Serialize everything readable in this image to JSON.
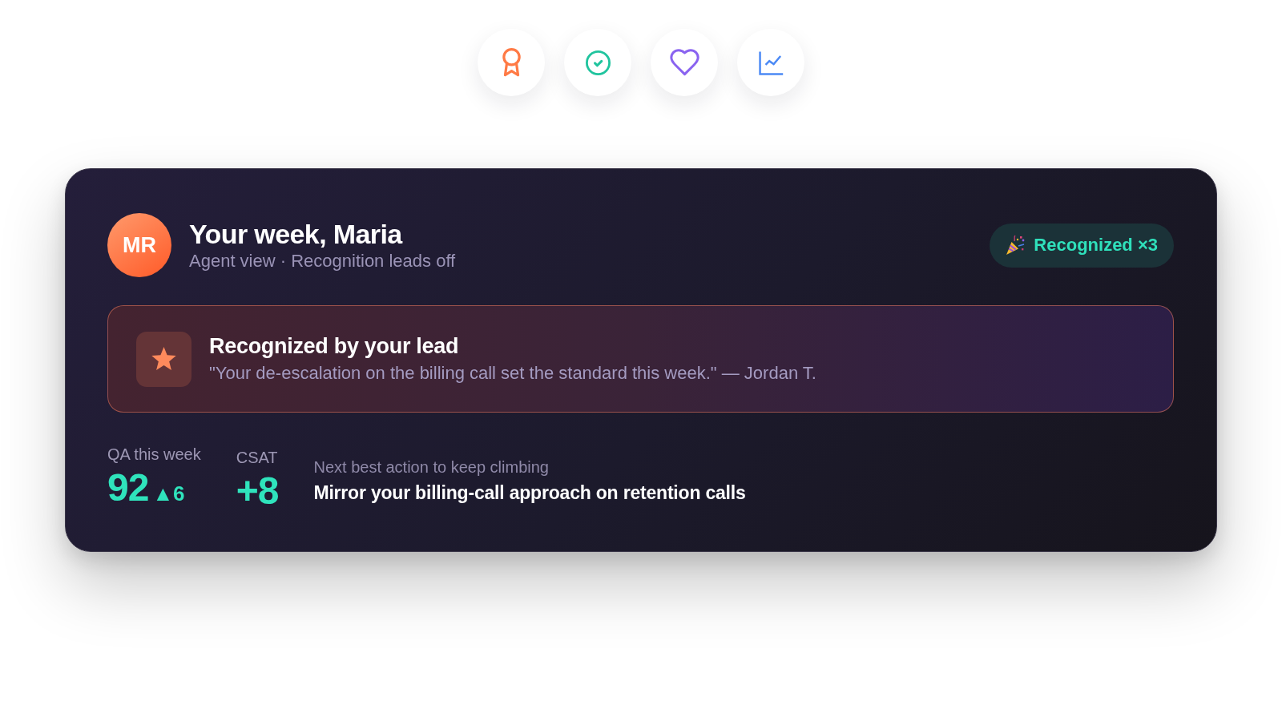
{
  "icon_buttons": [
    {
      "kind": "award"
    },
    {
      "kind": "check"
    },
    {
      "kind": "heart"
    },
    {
      "kind": "chart"
    }
  ],
  "card": {
    "header": {
      "avatar_initials": "MR",
      "title": "Your week, Maria",
      "subtitle": "Agent view · Recognition leads off",
      "badge": "Recognized ×3"
    },
    "recognition": {
      "title": "Recognized by your lead",
      "quote": "\"Your de-escalation on the billing call set the standard this week.\" — Jordan T."
    },
    "stats": [
      {
        "label": "QA this week",
        "value": "92",
        "change": "▲6"
      },
      {
        "label": "CSAT",
        "value": "+8"
      }
    ],
    "next_action": {
      "label": "Next best action to keep climbing",
      "text": "Mirror your billing-call approach on retention calls"
    }
  }
}
